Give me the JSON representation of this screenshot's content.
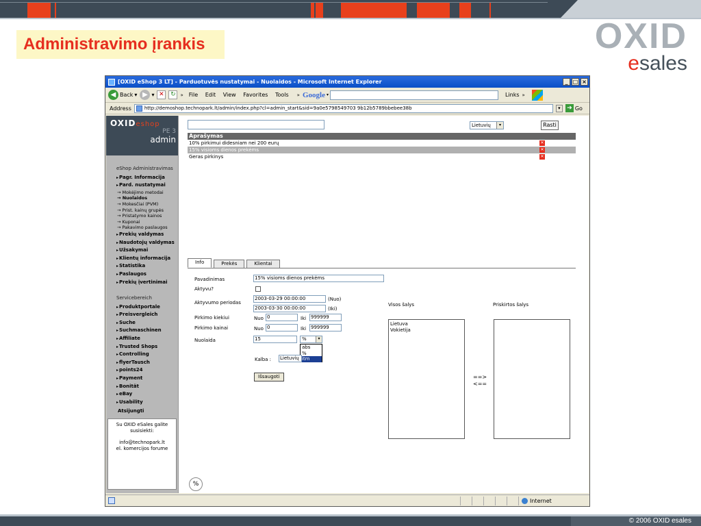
{
  "slide": {
    "title": "Administravimo įrankis",
    "logo_top": "OXID",
    "logo_bottom_e": "e",
    "logo_bottom_rest": "sales",
    "footer": "© 2006 OXID esales"
  },
  "browser": {
    "title": "[OXID eShop 3 LT] - Parduotuvės nustatymai - Nuolaidos - Microsoft Internet Explorer",
    "back_label": "Back",
    "menu": [
      "File",
      "Edit",
      "View",
      "Favorites",
      "Tools"
    ],
    "google_label": "Google",
    "links_label": "Links",
    "address_label": "Address",
    "url": "http://demoshop.technopark.lt/admin/index.php?cl=admin_start&sid=9a0e5798549703 9b12b5789bbebee38b",
    "go_label": "Go",
    "status_zone": "Internet"
  },
  "sidebar": {
    "logo_main": "OXID",
    "logo_e": "eshop",
    "logo_edition": "PE 3",
    "logo_admin": "admin",
    "header1": "eShop Administravimas",
    "items1": [
      {
        "label": "Pagr. Informacija",
        "type": "it"
      },
      {
        "label": "Pard. nustatymai",
        "type": "it"
      },
      {
        "label": "Mokėjimo metodai",
        "type": "sub"
      },
      {
        "label": "Nuolaidos",
        "type": "sub active"
      },
      {
        "label": "Mokesčiai (PVM)",
        "type": "sub"
      },
      {
        "label": "Prist. kainų grupės",
        "type": "sub"
      },
      {
        "label": "Pristatymo kainos",
        "type": "sub"
      },
      {
        "label": "Kuponai",
        "type": "sub"
      },
      {
        "label": "Pakavimo paslaugos",
        "type": "sub"
      },
      {
        "label": "Prekių valdymas",
        "type": "it"
      },
      {
        "label": "Naudotojų valdymas",
        "type": "it"
      },
      {
        "label": "Užsakymai",
        "type": "it"
      },
      {
        "label": "Klientų informacija",
        "type": "it"
      },
      {
        "label": "Statistika",
        "type": "it"
      },
      {
        "label": "Paslaugos",
        "type": "it"
      },
      {
        "label": "Prekių įvertinimai",
        "type": "it"
      }
    ],
    "header2": "Servicebereich",
    "items2": [
      "Produktportale",
      "Preisvergleich",
      "Suche",
      "Suchmaschinen",
      "Affiliate",
      "Trusted Shops",
      "Controlling",
      "flyerTausch",
      "points24",
      "Payment",
      "Bonität",
      "eBay",
      "Usability"
    ],
    "logout": "Atsijungti",
    "box_line1": "Su OXID eSales galite susisiekti:",
    "box_line2": "info@technopark.lt",
    "box_line3": "el. komercijos forume"
  },
  "list": {
    "lang_select": "Lietuvių",
    "find_button": "Rasti",
    "header": "Aprašymas",
    "rows": [
      {
        "text": "10% pirkimui didesniam nei 200 eurų",
        "selected": false
      },
      {
        "text": "15% visioms dienos prekėms",
        "selected": true
      },
      {
        "text": "Geras pirkinys",
        "selected": false
      }
    ],
    "delete_icon": "x"
  },
  "tabs": [
    "Info",
    "Prekės",
    "Klientai"
  ],
  "form": {
    "name_label": "Pavadinimas",
    "name_value": "15% visioms dienos prekėms",
    "active_label": "Aktyvu?",
    "period_label": "Aktyvumo periodas",
    "from_value": "2003-03-29 00:00:00",
    "from_suffix": "(Nuo)",
    "to_value": "2003-03-30 00:00:00",
    "to_suffix": "(Iki)",
    "qty_label": "Pirkimo kiekiui",
    "price_label": "Pirkimo kainai",
    "nuo": "Nuo",
    "iki": "Iki",
    "qty_from": "0",
    "qty_to": "999999",
    "price_from": "0",
    "price_to": "999999",
    "discount_label": "Nuolaida",
    "discount_value": "15",
    "discount_type": "%",
    "dropdown_options": [
      "abs",
      "%",
      "itm"
    ],
    "kalba_label": "Kalba :",
    "kalba_value": "Lietuvių",
    "save_button": "Išsaugoti",
    "all_countries_label": "Visos šalys",
    "assigned_countries_label": "Priskirtos šalys",
    "countries": [
      "Lietuva",
      "Vokietija"
    ],
    "arrow_right": "==>",
    "arrow_left": "<==",
    "percent_icon": "%"
  }
}
